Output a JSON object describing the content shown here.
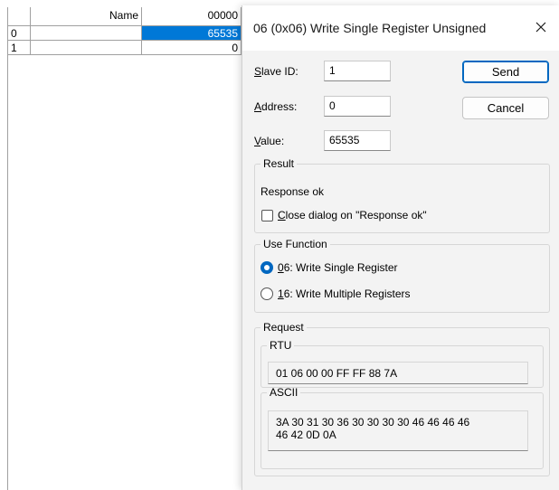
{
  "grid": {
    "header": {
      "name": "Name",
      "value": "00000"
    },
    "rows": [
      {
        "index": "0",
        "name": "",
        "value": "65535"
      },
      {
        "index": "1",
        "name": "",
        "value": "0"
      }
    ]
  },
  "dialog": {
    "title": "06 (0x06) Write Single Register Unsigned",
    "fields": {
      "slave_id": {
        "accesskey": "S",
        "rest": "lave ID:",
        "value": "1"
      },
      "address": {
        "accesskey": "A",
        "rest": "ddress:",
        "value": "0"
      },
      "value": {
        "accesskey": "V",
        "rest": "alue:",
        "value": "65535"
      }
    },
    "buttons": {
      "send": "Send",
      "cancel": "Cancel"
    },
    "result": {
      "legend": "Result",
      "status": "Response ok",
      "close_option_accesskey": "C",
      "close_option_rest": "lose dialog on \"Response ok\"",
      "close_option_checked": false
    },
    "use_function": {
      "legend": "Use Function",
      "options": [
        {
          "accesskey": "0",
          "rest": "6: Write Single Register",
          "selected": true
        },
        {
          "accesskey": "1",
          "rest": "6: Write Multiple Registers",
          "selected": false
        }
      ]
    },
    "request": {
      "legend": "Request",
      "rtu": {
        "legend": "RTU",
        "value": "01 06 00 00 FF FF 88 7A"
      },
      "ascii": {
        "legend": "ASCII",
        "line1": "3A 30 31 30 36 30 30 30 30 46 46 46 46",
        "line2": "46 42 0D 0A"
      }
    }
  },
  "colors": {
    "selection": "#0078d7",
    "accent": "#0067c0",
    "dialog_bg": "#f3f3f3"
  },
  "icons": {
    "close": "close-icon"
  }
}
